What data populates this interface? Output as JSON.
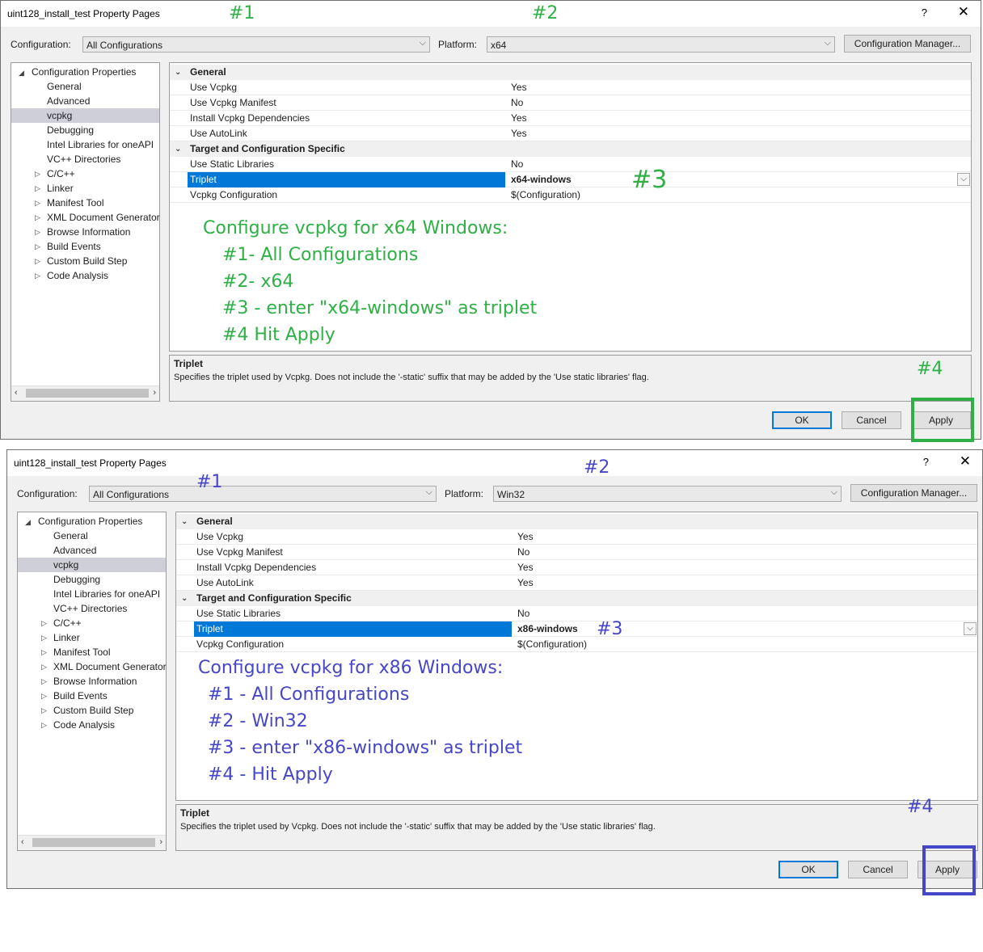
{
  "dialog1": {
    "title": "uint128_install_test Property Pages",
    "help": "?",
    "close": "✕",
    "config_label": "Configuration:",
    "config_value": "All Configurations",
    "platform_label": "Platform:",
    "platform_value": "x64",
    "config_manager": "Configuration Manager...",
    "tree": {
      "root": "Configuration Properties",
      "items": [
        "General",
        "Advanced",
        "vcpkg",
        "Debugging",
        "Intel Libraries for oneAPI",
        "VC++ Directories",
        "C/C++",
        "Linker",
        "Manifest Tool",
        "XML Document Generator",
        "Browse Information",
        "Build Events",
        "Custom Build Step",
        "Code Analysis"
      ]
    },
    "grid": {
      "general": "General",
      "use_vcpkg": "Use Vcpkg",
      "use_vcpkg_val": "Yes",
      "use_manifest": "Use Vcpkg Manifest",
      "use_manifest_val": "No",
      "install_deps": "Install Vcpkg Dependencies",
      "install_deps_val": "Yes",
      "autolink": "Use AutoLink",
      "autolink_val": "Yes",
      "target": "Target and Configuration Specific",
      "static": "Use Static Libraries",
      "static_val": "No",
      "triplet": "Triplet",
      "triplet_val": "x64-windows",
      "vcpkg_config": "Vcpkg Configuration",
      "vcpkg_config_val": "$(Configuration)"
    },
    "desc_title": "Triplet",
    "desc_text": "Specifies the triplet used by Vcpkg. Does not include the '-static' suffix that may be added by the 'Use static libraries' flag.",
    "ok": "OK",
    "cancel": "Cancel",
    "apply": "Apply",
    "notes": {
      "n1": "#1",
      "n2": "#2",
      "n3": "#3",
      "n4": "#4",
      "heading": "Configure vcpkg for x64 Windows:",
      "l1": "#1- All Configurations",
      "l2": "#2- x64",
      "l3": "#3 - enter \"x64-windows\" as triplet",
      "l4": "#4 Hit Apply"
    }
  },
  "dialog2": {
    "title": "uint128_install_test Property Pages",
    "help": "?",
    "close": "✕",
    "config_label": "Configuration:",
    "config_value": "All Configurations",
    "platform_label": "Platform:",
    "platform_value": "Win32",
    "config_manager": "Configuration Manager...",
    "tree": {
      "root": "Configuration Properties",
      "items": [
        "General",
        "Advanced",
        "vcpkg",
        "Debugging",
        "Intel Libraries for oneAPI",
        "VC++ Directories",
        "C/C++",
        "Linker",
        "Manifest Tool",
        "XML Document Generator",
        "Browse Information",
        "Build Events",
        "Custom Build Step",
        "Code Analysis"
      ]
    },
    "grid": {
      "general": "General",
      "use_vcpkg": "Use Vcpkg",
      "use_vcpkg_val": "Yes",
      "use_manifest": "Use Vcpkg Manifest",
      "use_manifest_val": "No",
      "install_deps": "Install Vcpkg Dependencies",
      "install_deps_val": "Yes",
      "autolink": "Use AutoLink",
      "autolink_val": "Yes",
      "target": "Target and Configuration Specific",
      "static": "Use Static Libraries",
      "static_val": "No",
      "triplet": "Triplet",
      "triplet_val": "x86-windows",
      "vcpkg_config": "Vcpkg Configuration",
      "vcpkg_config_val": "$(Configuration)"
    },
    "desc_title": "Triplet",
    "desc_text": "Specifies the triplet used by Vcpkg. Does not include the '-static' suffix that may be added by the 'Use static libraries' flag.",
    "ok": "OK",
    "cancel": "Cancel",
    "apply": "Apply",
    "notes": {
      "n1": "#1",
      "n2": "#2",
      "n3": "#3",
      "n4": "#4",
      "heading": "Configure vcpkg for x86 Windows:",
      "l1": "#1 - All Configurations",
      "l2": "#2 - Win32",
      "l3": "#3 - enter \"x86-windows\" as triplet",
      "l4": "#4 - Hit Apply"
    }
  },
  "colors": {
    "annotation_green": "#2eb045",
    "annotation_blue": "#4646c8",
    "selection": "#0078d7"
  }
}
